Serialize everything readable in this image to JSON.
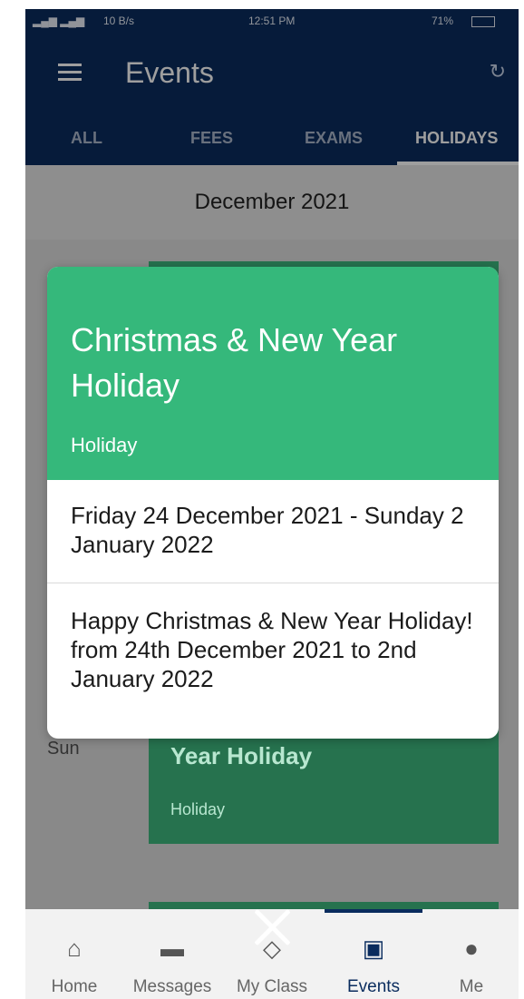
{
  "status_bar": {
    "network": "10 B/s",
    "time": "12:51 PM",
    "battery": "71%"
  },
  "app_bar": {
    "title": "Events",
    "menu_icon": "hamburger-icon",
    "refresh_icon": "refresh-icon"
  },
  "tabs": [
    {
      "label": "ALL"
    },
    {
      "label": "FEES"
    },
    {
      "label": "EXAMS"
    },
    {
      "label": "HOLIDAYS",
      "active": true
    }
  ],
  "month_header": "December 2021",
  "background_event": {
    "day": "Sun",
    "title_fragment": "Year Holiday",
    "category": "Holiday"
  },
  "modal": {
    "title": "Christmas & New Year Holiday",
    "category": "Holiday",
    "dates": "Friday 24 December 2021 - Sunday 2 January 2022",
    "description": "Happy Christmas & New Year Holiday! from 24th December 2021 to 2nd January 2022",
    "close_icon": "close-icon"
  },
  "bottom_nav": [
    {
      "label": "Home",
      "icon": "home-icon"
    },
    {
      "label": "Messages",
      "icon": "messages-icon"
    },
    {
      "label": "My Class",
      "icon": "class-icon"
    },
    {
      "label": "Events",
      "icon": "calendar-icon",
      "active": true
    },
    {
      "label": "Me",
      "icon": "person-icon"
    }
  ],
  "colors": {
    "primary": "#0a2c5e",
    "event_green": "#35b87b"
  }
}
